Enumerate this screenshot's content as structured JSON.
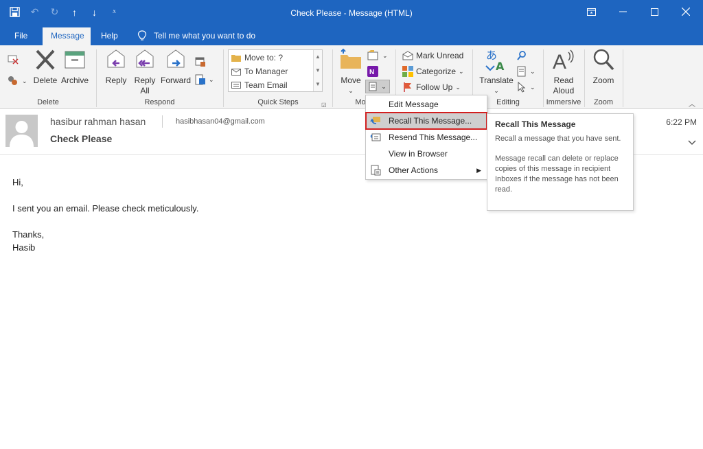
{
  "window": {
    "title": "Check Please  -  Message (HTML)",
    "controls": {
      "restore": "⧉",
      "minimize": "—",
      "maximize": "☐",
      "close": "✕"
    }
  },
  "qat": {
    "save": "💾",
    "undo": "↶",
    "redo": "↻",
    "up": "↑",
    "down": "↓",
    "customize": "⩡"
  },
  "tabs": [
    {
      "label": "File"
    },
    {
      "label": "Message"
    },
    {
      "label": "Help"
    }
  ],
  "tell_me": {
    "label": "Tell me what you want to do",
    "icon": "lightbulb-icon"
  },
  "ribbon": {
    "delete_group": {
      "label": "Delete",
      "delete": "Delete",
      "archive": "Archive"
    },
    "respond_group": {
      "label": "Respond",
      "reply": "Reply",
      "reply_all_1": "Reply",
      "reply_all_2": "All",
      "forward": "Forward"
    },
    "quick_steps": {
      "label": "Quick Steps",
      "items": [
        {
          "label": "Move to: ?"
        },
        {
          "label": "To Manager"
        },
        {
          "label": "Team Email"
        }
      ]
    },
    "move_group": {
      "label": "Mo",
      "move": "Move"
    },
    "tags_group": {
      "mark_unread": "Mark Unread",
      "categorize": "Categorize",
      "follow_up": "Follow Up"
    },
    "editing_group": {
      "label": "Editing",
      "translate": "Translate"
    },
    "immersive_group": {
      "label": "Immersive",
      "read_aloud_1": "Read",
      "read_aloud_2": "Aloud"
    },
    "zoom_group": {
      "label": "Zoom",
      "zoom": "Zoom"
    }
  },
  "message": {
    "sender": "hasibur rahman hasan",
    "email": "hasibhasan04@gmail.com",
    "subject": "Check Please",
    "time": "6:22 PM",
    "body": {
      "greeting": "Hi,",
      "line1": "I sent you an email. Please check meticulously.",
      "closing": "Thanks,",
      "signature": "Hasib"
    }
  },
  "actions_menu": {
    "items": [
      {
        "label": "Edit Message"
      },
      {
        "label": "Recall This Message..."
      },
      {
        "label": "Resend This Message..."
      },
      {
        "label": "View in Browser"
      },
      {
        "label": "Other Actions"
      }
    ]
  },
  "tooltip": {
    "title": "Recall This Message",
    "p1": "Recall a message that you have sent.",
    "p2": "Message recall can delete or replace copies of this message in recipient Inboxes if the message has not been read."
  },
  "colors": {
    "brand_blue": "#1e65c0",
    "highlight_outline": "#d21f1f"
  }
}
